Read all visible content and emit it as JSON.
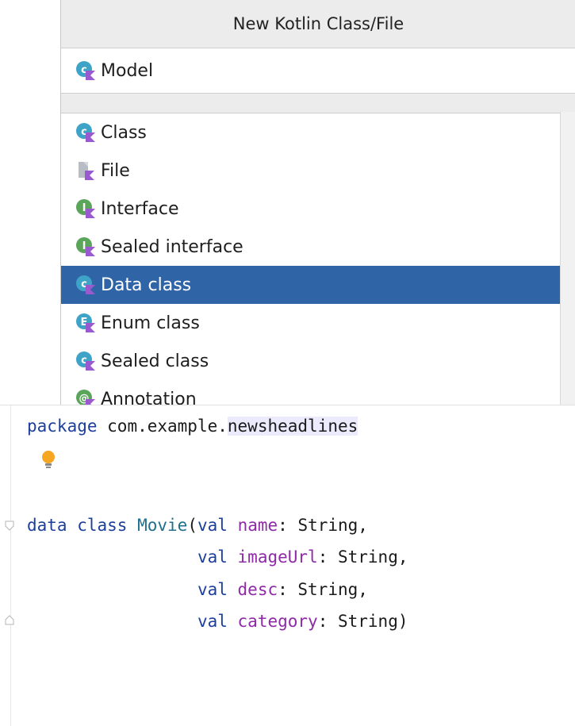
{
  "dialog": {
    "title": "New Kotlin Class/File",
    "name_field": {
      "value": "Model",
      "icon": "kotlin-class-icon"
    },
    "items": [
      {
        "label": "Class",
        "icon": "kotlin-class-icon",
        "selected": false
      },
      {
        "label": "File",
        "icon": "kotlin-file-icon",
        "selected": false
      },
      {
        "label": "Interface",
        "icon": "kotlin-interface-icon",
        "selected": false
      },
      {
        "label": "Sealed interface",
        "icon": "kotlin-interface-icon",
        "selected": false
      },
      {
        "label": "Data class",
        "icon": "kotlin-class-icon",
        "selected": true
      },
      {
        "label": "Enum class",
        "icon": "kotlin-enum-icon",
        "selected": false
      },
      {
        "label": "Sealed class",
        "icon": "kotlin-class-icon",
        "selected": false
      },
      {
        "label": "Annotation",
        "icon": "kotlin-annotation-icon",
        "selected": false
      }
    ]
  },
  "editor": {
    "line1": {
      "kw": "package",
      "rest": " com.example.",
      "hl": "newsheadlines"
    },
    "line2": {
      "kw1": "data",
      "sp1": " ",
      "kw2": "class",
      "sp2": " ",
      "name": "Movie",
      "open": "(",
      "val": "val",
      "sp3": " ",
      "param": "name",
      "type": ": String,"
    },
    "line3": {
      "indent": "                 ",
      "val": "val",
      "sp": " ",
      "param": "imageUrl",
      "type": ": String,"
    },
    "line4": {
      "indent": "                 ",
      "val": "val",
      "sp": " ",
      "param": "desc",
      "type": ": String,"
    },
    "line5": {
      "indent": "                 ",
      "val": "val",
      "sp": " ",
      "param": "category",
      "type": ": String)"
    }
  },
  "colors": {
    "selection": "#2f64a6",
    "keyword": "#1d3f9a",
    "parameter": "#8e2aa7",
    "class_name": "#1f6f8e",
    "highlight": "#ecebfd"
  }
}
